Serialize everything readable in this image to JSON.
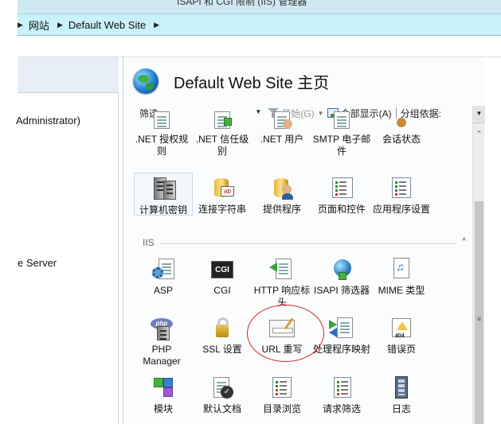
{
  "window": {
    "title_partial": "ISAPI 和 CGI 限制 (IIS) 管理器"
  },
  "breadcrumb": {
    "items": [
      "网站",
      "Default Web Site"
    ]
  },
  "left_pane": {
    "lines": [
      "Administrator)",
      "e Server"
    ]
  },
  "main": {
    "title": "Default Web Site 主页",
    "filter": {
      "label": "筛选:",
      "start_label": "开始(G)",
      "show_all_label": "全部显示(A)",
      "group_by_label": "分组依据:"
    },
    "top_row": [
      {
        "label": ".NET 授权规则",
        "icon": "lock-doc-icon"
      },
      {
        "label": ".NET 信任级别",
        "icon": "check-doc-icon"
      },
      {
        "label": ".NET 用户",
        "icon": "users-doc-icon"
      },
      {
        "label": "SMTP 电子邮件",
        "icon": "mail-icon"
      },
      {
        "label": "会话状态",
        "icon": "session-icon"
      }
    ],
    "second_row": [
      {
        "label": "计算机密钥",
        "icon": "machine-key-icon"
      },
      {
        "label": "连接字符串",
        "icon": "connection-string-icon"
      },
      {
        "label": "提供程序",
        "icon": "providers-icon"
      },
      {
        "label": "页面和控件",
        "icon": "pages-controls-icon"
      },
      {
        "label": "应用程序设置",
        "icon": "app-settings-icon"
      }
    ],
    "section": {
      "name": "IIS"
    },
    "iis_row1": [
      {
        "label": "ASP",
        "icon": "asp-icon"
      },
      {
        "label": "CGI",
        "icon": "cgi-icon",
        "badge": "CGI"
      },
      {
        "label": "HTTP 响应标头",
        "icon": "http-headers-icon"
      },
      {
        "label": "ISAPI 筛选器",
        "icon": "isapi-filter-icon"
      },
      {
        "label": "MIME 类型",
        "icon": "mime-icon"
      }
    ],
    "iis_row2": [
      {
        "label": "PHP Manager",
        "icon": "php-icon",
        "badge": "php"
      },
      {
        "label": "SSL 设置",
        "icon": "ssl-lock-icon"
      },
      {
        "label": "URL 重写",
        "icon": "url-rewrite-icon"
      },
      {
        "label": "处理程序映射",
        "icon": "handler-mapping-icon"
      },
      {
        "label": "错误页",
        "icon": "error-page-icon",
        "badge": "404"
      }
    ],
    "iis_row3": [
      {
        "label": "模块",
        "icon": "modules-icon"
      },
      {
        "label": "默认文档",
        "icon": "default-doc-icon"
      },
      {
        "label": "目录浏览",
        "icon": "directory-browse-icon"
      },
      {
        "label": "请求筛选",
        "icon": "request-filter-icon"
      },
      {
        "label": "日志",
        "icon": "logging-icon"
      }
    ]
  },
  "colors": {
    "breadcrumb_bg": "#c9f1f9",
    "annotation_circle": "#d82020"
  }
}
